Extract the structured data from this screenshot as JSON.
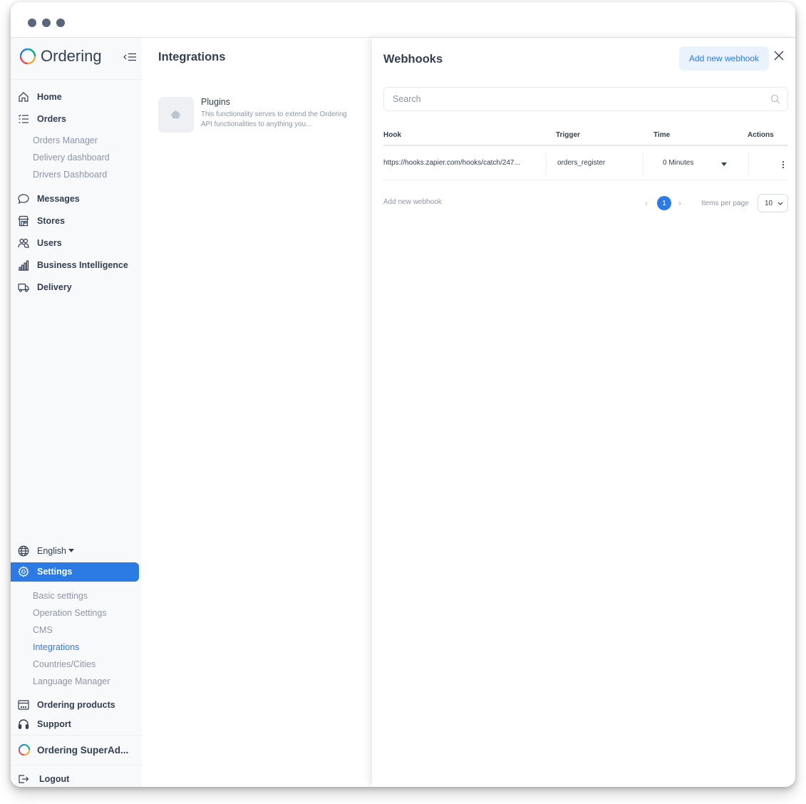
{
  "window": {
    "controls": [
      "dot",
      "dot",
      "dot"
    ]
  },
  "sidebar": {
    "logo": "Ordering",
    "nav": [
      {
        "label": "Home",
        "icon": "home-icon"
      },
      {
        "label": "Orders",
        "icon": "list-icon"
      },
      {
        "label": "Messages",
        "icon": "chat-icon"
      },
      {
        "label": "Stores",
        "icon": "store-icon"
      },
      {
        "label": "Users",
        "icon": "users-icon"
      },
      {
        "label": "Business Intelligence",
        "icon": "bar-chart-icon"
      },
      {
        "label": "Delivery",
        "icon": "truck-icon"
      }
    ],
    "orders_sub": [
      "Orders Manager",
      "Delivery dashboard",
      "Drivers Dashboard"
    ],
    "language": "English",
    "settings": "Settings",
    "settings_sub": [
      "Basic settings",
      "Operation Settings",
      "CMS",
      "Integrations",
      "Countries/Cities",
      "Language Manager"
    ],
    "ordering_products": "Ordering products",
    "support": "Support",
    "user": "Ordering SuperAd...",
    "logout": "Logout",
    "accent": "#2c7be5"
  },
  "main": {
    "title": "Integrations",
    "plugin": {
      "title": "Plugins",
      "description": "This functionality serves to extend the Ordering API functionalities to anything you..."
    }
  },
  "panel": {
    "title": "Webhooks",
    "add_button": "Add new webhook",
    "search_placeholder": "Search",
    "columns": [
      "Hook",
      "Trigger",
      "Time",
      "Actions"
    ],
    "rows": [
      {
        "hook": "https://hooks.zapier.com/hooks/catch/247...",
        "trigger": "orders_register",
        "time": "0 Minutes"
      }
    ],
    "footer_link": "Add new webhook",
    "pagination": {
      "current": "1",
      "items_per_page_label": "Items per page",
      "items_per_page": "10"
    }
  }
}
